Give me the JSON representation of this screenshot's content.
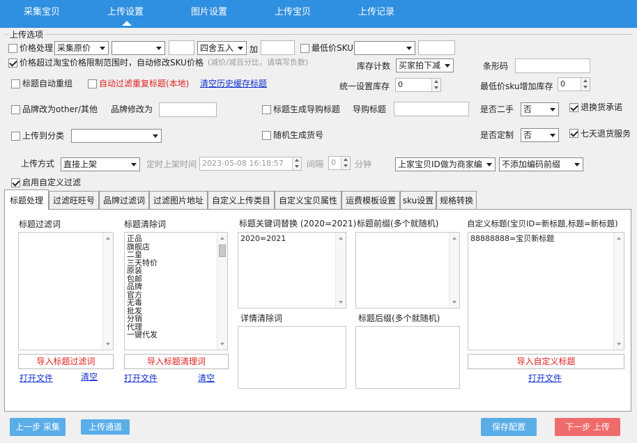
{
  "nav": {
    "items": [
      "采集宝贝",
      "上传设置",
      "图片设置",
      "上传宝贝",
      "上传记录"
    ],
    "active_index": 1
  },
  "options": {
    "group_title": "上传选项",
    "price_process_label": "价格处理",
    "price_source": "采集原价",
    "price_op": "",
    "price_value": "",
    "rounding": "四舍五入",
    "add_label": "加",
    "add_value": "",
    "lowest_sku_label": "最低价SKU",
    "lowest_sku_select": "",
    "lowest_sku_value": "",
    "auto_modify_label": "价格超过淘宝价格限制范围时，自动修改SKU价格",
    "auto_modify_hint": "(减价/减百分比，请填写负数)",
    "stock_count_label": "库存计数",
    "stock_count_value": "买家拍下减",
    "barcode_label": "条形码",
    "barcode_value": "",
    "title_regroup_label": "标题自动重组",
    "auto_filter_dup_label": "自动过滤重复标题(本地)",
    "clear_cache_link": "清空历史缓存标题",
    "unified_stock_label": "统一设置库存",
    "unified_stock_value": "0",
    "lowest_sku_add_stock_label": "最低价sku增加库存",
    "lowest_sku_add_stock_value": "0",
    "brand_other_label": "品牌改为other/其他",
    "brand_modify_label": "品牌修改为",
    "brand_modify_value": "",
    "title_guide_label": "标题生成导购标题",
    "guide_title_label": "导购标题",
    "guide_title_value": "",
    "second_hand_label": "是否二手",
    "second_hand_value": "否",
    "return_promise_label": "退换货承诺",
    "upload_category_label": "上传到分类",
    "upload_category_value": "",
    "random_item_no_label": "随机生成货号",
    "custom_made_label": "是否定制",
    "custom_made_value": "否",
    "seven_day_label": "七天退货服务",
    "upload_method_label": "上传方式",
    "upload_method_value": "直接上架",
    "scheduled_label": "定时上架时间",
    "scheduled_value": "2023-05-08 16:18:57",
    "interval_label": "间隔",
    "interval_value": "0",
    "minute_label": "分钟",
    "merchant_code_value": "上家宝贝ID做为商家编",
    "code_prefix_value": "不添加编码前缀",
    "custom_filter_label": "启用自定义过滤"
  },
  "tabs": [
    "标题处理",
    "过滤旺旺号",
    "品牌过滤词",
    "过滤图片地址",
    "自定义上传类目",
    "自定义宝贝属性",
    "运费模板设置",
    "sku设置",
    "规格转换"
  ],
  "panel": {
    "title_filter_label": "标题过滤词",
    "title_filter_text": "",
    "import_title_filter_button": "导入标题过滤词",
    "open_file_1": "打开文件",
    "clear_1": "清空",
    "title_clear_label": "标题清除词",
    "title_clear_words": [
      "正品",
      "旗舰店",
      "二皇",
      "三天特价",
      "原装",
      "包邮",
      "品牌",
      "官方",
      "无毒",
      "批发",
      "分销",
      "代理",
      "一键代发"
    ],
    "import_title_clear_button": "导入标题清理词",
    "open_file_2": "打开文件",
    "clear_2": "清空",
    "keyword_replace_label": "标题关键词替换 (2020=2021)",
    "keyword_replace_text": "2020=2021",
    "detail_clear_label": "详情清除词",
    "detail_clear_text": "",
    "prefix_label": "标题前缀(多个就随机)",
    "prefix_text": "",
    "suffix_label": "标题后缀(多个就随机)",
    "suffix_text": "",
    "custom_title_label": "自定义标题(宝贝ID=新标题,标题=新标题)",
    "custom_title_text": "88888888=宝贝新标题",
    "import_custom_title_button": "导入自定义标题",
    "open_file_3": "打开文件"
  },
  "footer": {
    "prev_button": "上一步 采集",
    "channel_button": "上传通道",
    "save_button": "保存配置",
    "next_button": "下一步 上传"
  },
  "colors": {
    "topbar": "#2f8fe0",
    "button_blue": "#5aaee8",
    "button_red": "#f06b6b",
    "link": "#1030d0",
    "red_text": "#e02020"
  }
}
